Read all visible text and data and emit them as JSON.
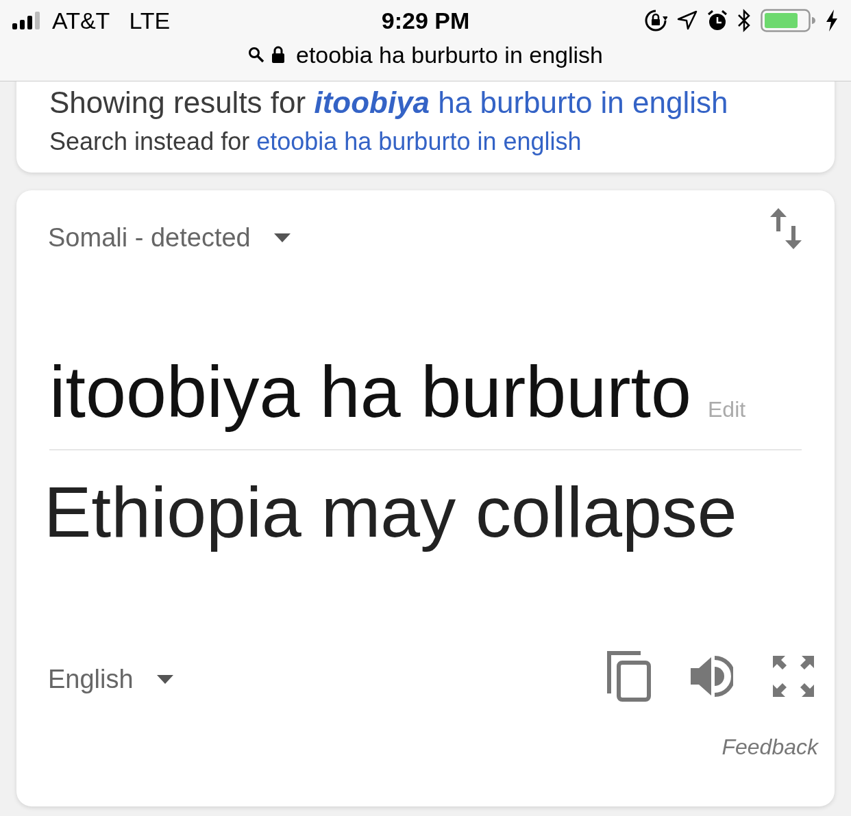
{
  "status_bar": {
    "carrier": "AT&T",
    "network": "LTE",
    "time": "9:29 PM"
  },
  "address_bar": {
    "url": "etoobia ha burburto in english",
    "secure": true
  },
  "spelling_card": {
    "showing_label": "Showing results for",
    "corrected_query": "**itoobiya** ha burburto in english",
    "instead_label": "Search instead for",
    "original_query": "etoobia ha burburto in english"
  },
  "translator": {
    "source_language": "Somali - detected",
    "source_text": "itoobiya ha burburto",
    "edit_label": "Edit",
    "translation": "Ethiopia may collapse",
    "target_language": "English",
    "feedback": "Feedback"
  }
}
